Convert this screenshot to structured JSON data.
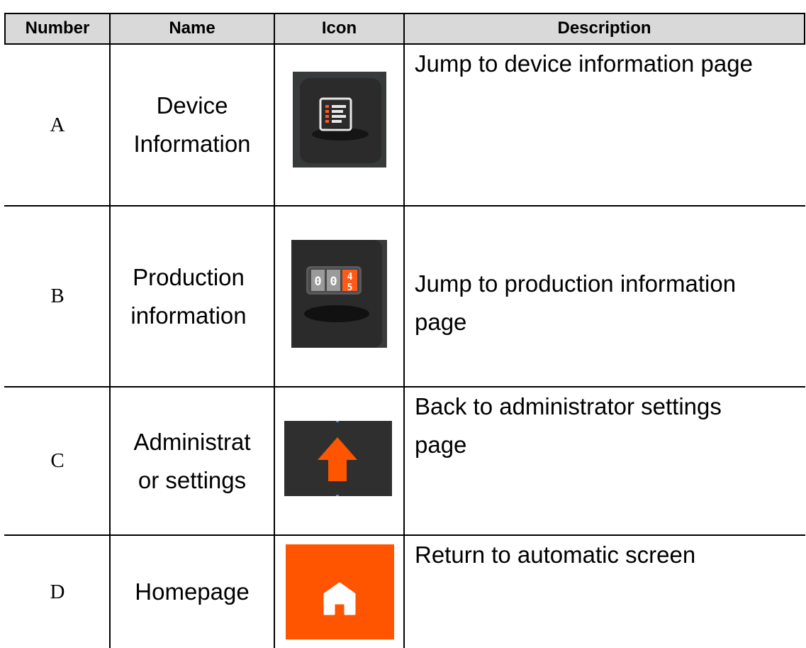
{
  "table": {
    "headers": {
      "number": "Number",
      "name": "Name",
      "icon": "Icon",
      "description": "Description"
    },
    "rows": [
      {
        "number": "A",
        "name_line1": "Device",
        "name_line2": "Information",
        "icon": "device-information-icon",
        "desc_line1": "Jump to device information page",
        "desc_line2": ""
      },
      {
        "number": "B",
        "name_line1": "Production",
        "name_line2": "information",
        "icon": "production-counter-icon",
        "counter": {
          "d1": "0",
          "d2": "0",
          "d3_top": "4",
          "d3_bottom": "5"
        },
        "desc_line1": "Jump to production information",
        "desc_line2": "page"
      },
      {
        "number": "C",
        "name_line1": "Administrat",
        "name_line2": "or settings",
        "icon": "up-arrow-icon",
        "desc_line1": "Back to administrator settings",
        "desc_line2": "page"
      },
      {
        "number": "D",
        "name_line1": "Homepage",
        "name_line2": "",
        "icon": "home-icon",
        "desc_line1": "Return to automatic screen",
        "desc_line2": ""
      }
    ]
  },
  "colors": {
    "header_bg": "#d9d9d9",
    "icon_dark": "#2f2f2f",
    "accent_orange": "#ff5500"
  }
}
